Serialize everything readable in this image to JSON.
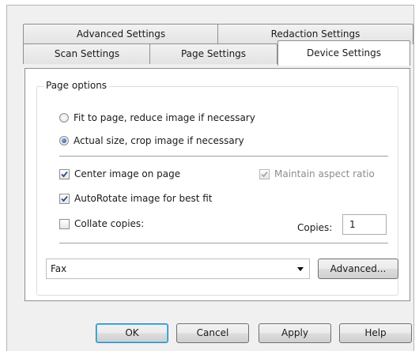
{
  "tabs": {
    "row_back": [
      {
        "label": "Advanced Settings"
      },
      {
        "label": "Redaction Settings"
      }
    ],
    "row_front": [
      {
        "label": "Scan Settings"
      },
      {
        "label": "Page Settings"
      },
      {
        "label": "Device Settings",
        "active": true
      }
    ]
  },
  "page_options": {
    "legend": "Page options",
    "fit_to_page": {
      "label": "Fit to page, reduce image if necessary",
      "selected": false
    },
    "actual_size": {
      "label": "Actual size, crop image if necessary",
      "selected": true
    },
    "center_image": {
      "label": "Center image on page",
      "checked": true
    },
    "maintain_aspect": {
      "label": "Maintain aspect ratio",
      "checked": true,
      "enabled": false
    },
    "autorotate": {
      "label": "AutoRotate image for best fit",
      "checked": true
    },
    "collate": {
      "label": "Collate copies:",
      "checked": false
    },
    "copies": {
      "label": "Copies:",
      "value": "1"
    }
  },
  "printer": {
    "selected": "Fax",
    "advanced_label": "Advanced..."
  },
  "buttons": {
    "ok": "OK",
    "cancel": "Cancel",
    "apply": "Apply",
    "help": "Help"
  }
}
